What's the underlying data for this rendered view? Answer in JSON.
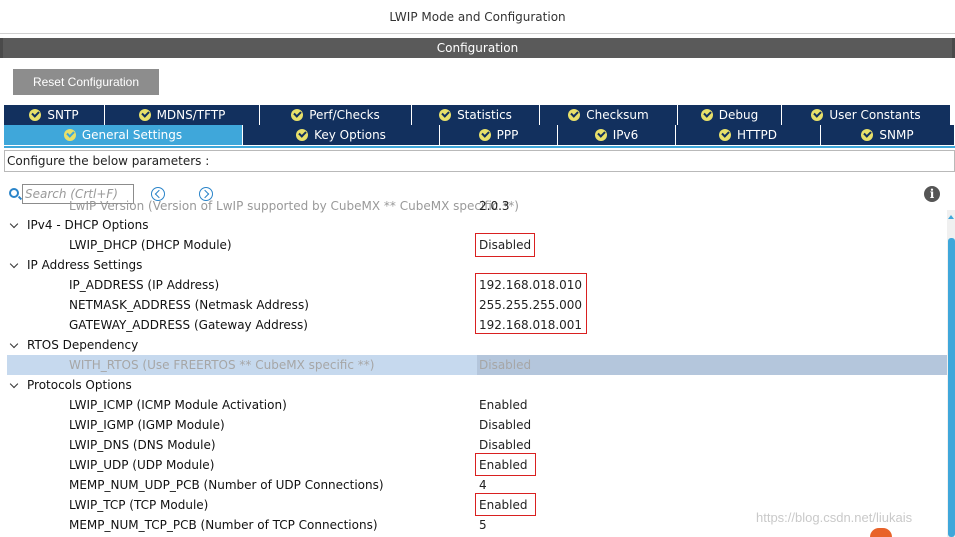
{
  "window": {
    "title": "LWIP Mode and Configuration"
  },
  "section": {
    "title": "Configuration"
  },
  "toolbar": {
    "reset_label": "Reset Configuration"
  },
  "tabs_row1": [
    {
      "label": "SNTP"
    },
    {
      "label": "MDNS/TFTP"
    },
    {
      "label": "Perf/Checks"
    },
    {
      "label": "Statistics"
    },
    {
      "label": "Checksum"
    },
    {
      "label": "Debug"
    },
    {
      "label": "User Constants"
    }
  ],
  "tabs_row2": [
    {
      "label": "General Settings",
      "active": true
    },
    {
      "label": "Key Options"
    },
    {
      "label": "PPP"
    },
    {
      "label": "IPv6"
    },
    {
      "label": "HTTPD"
    },
    {
      "label": "SNMP"
    }
  ],
  "instructions": "Configure the below parameters :",
  "search": {
    "placeholder": "Search (Crtl+F)"
  },
  "tree": {
    "cut_row": {
      "label": "LwIP Version (Version of LwIP supported by CubeMX ** CubeMX specific **)",
      "value": "2.0.3"
    },
    "rows": [
      {
        "type": "group",
        "label": "IPv4 - DHCP Options"
      },
      {
        "type": "param",
        "label": "LWIP_DHCP (DHCP Module)",
        "value": "Disabled"
      },
      {
        "type": "group",
        "label": "IP Address Settings"
      },
      {
        "type": "param",
        "label": "IP_ADDRESS (IP Address)",
        "value": "192.168.018.010"
      },
      {
        "type": "param",
        "label": "NETMASK_ADDRESS (Netmask Address)",
        "value": "255.255.255.000"
      },
      {
        "type": "param",
        "label": "GATEWAY_ADDRESS (Gateway Address)",
        "value": "192.168.018.001"
      },
      {
        "type": "group",
        "label": "RTOS Dependency"
      },
      {
        "type": "param",
        "label": "WITH_RTOS (Use FREERTOS ** CubeMX specific **)",
        "value": "Disabled",
        "selected": true
      },
      {
        "type": "group",
        "label": "Protocols Options"
      },
      {
        "type": "param",
        "label": "LWIP_ICMP (ICMP Module Activation)",
        "value": "Enabled"
      },
      {
        "type": "param",
        "label": "LWIP_IGMP (IGMP Module)",
        "value": "Disabled"
      },
      {
        "type": "param",
        "label": "LWIP_DNS (DNS Module)",
        "value": "Disabled"
      },
      {
        "type": "param",
        "label": "LWIP_UDP (UDP Module)",
        "value": "Enabled"
      },
      {
        "type": "param",
        "label": "MEMP_NUM_UDP_PCB (Number of UDP Connections)",
        "value": "4"
      },
      {
        "type": "param",
        "label": "LWIP_TCP (TCP Module)",
        "value": "Enabled"
      },
      {
        "type": "param",
        "label": "MEMP_NUM_TCP_PCB (Number of TCP Connections)",
        "value": "5"
      }
    ]
  },
  "colors": {
    "tab_bg": "#12305e",
    "tab_active": "#3fa7da",
    "highlight_box": "#d92020",
    "selected_row": "#c6d9ee"
  },
  "icons": {
    "tab_status": "check-circle-icon",
    "search": "search-icon",
    "prev": "arrow-left-circle-icon",
    "next": "arrow-right-circle-icon",
    "info": "info-icon"
  },
  "watermark": "https://blog.csdn.net/liukais"
}
